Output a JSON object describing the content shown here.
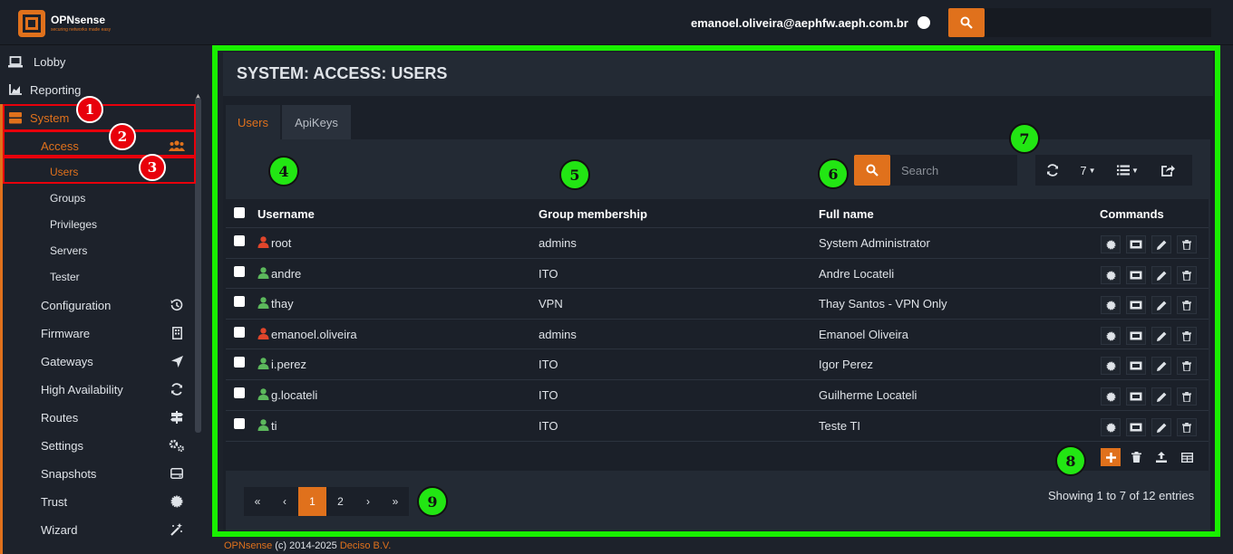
{
  "header": {
    "brand": "OPNsense",
    "tagline": "securing networks made easy",
    "user_email": "emanoel.oliveira@aephfw.aeph.com.br",
    "search_placeholder": ""
  },
  "sidebar": {
    "items": [
      {
        "label": "Lobby",
        "icon": "laptop-icon"
      },
      {
        "label": "Reporting",
        "icon": "area-chart-icon"
      },
      {
        "label": "System",
        "icon": "server-icon",
        "active": true
      },
      {
        "label": "Access",
        "icon": "users-icon",
        "active": true
      },
      {
        "label": "Users",
        "active": true
      },
      {
        "label": "Groups"
      },
      {
        "label": "Privileges"
      },
      {
        "label": "Servers"
      },
      {
        "label": "Tester"
      },
      {
        "label": "Configuration",
        "icon": "history-icon"
      },
      {
        "label": "Firmware",
        "icon": "building-icon"
      },
      {
        "label": "Gateways",
        "icon": "location-arrow-icon"
      },
      {
        "label": "High Availability",
        "icon": "refresh-icon"
      },
      {
        "label": "Routes",
        "icon": "map-signs-icon"
      },
      {
        "label": "Settings",
        "icon": "cogs-icon"
      },
      {
        "label": "Snapshots",
        "icon": "hdd-icon"
      },
      {
        "label": "Trust",
        "icon": "certificate-icon"
      },
      {
        "label": "Wizard",
        "icon": "magic-icon"
      }
    ]
  },
  "annotations": {
    "red": [
      "1",
      "2",
      "3"
    ],
    "green": [
      "4",
      "5",
      "6",
      "7",
      "8",
      "9"
    ]
  },
  "page": {
    "title": "SYSTEM: ACCESS: USERS",
    "tabs": [
      {
        "label": "Users",
        "active": true
      },
      {
        "label": "ApiKeys",
        "active": false
      }
    ],
    "search_placeholder": "Search",
    "row_count": "7",
    "table": {
      "columns": [
        "Username",
        "Group membership",
        "Full name",
        "Commands"
      ],
      "rows": [
        {
          "username": "root",
          "group": "admins",
          "fullname": "System Administrator",
          "admin": true
        },
        {
          "username": "andre",
          "group": "ITO",
          "fullname": "Andre Locateli",
          "admin": false
        },
        {
          "username": "thay",
          "group": "VPN",
          "fullname": "Thay Santos - VPN Only",
          "admin": false
        },
        {
          "username": "emanoel.oliveira",
          "group": "admins",
          "fullname": "Emanoel Oliveira",
          "admin": true
        },
        {
          "username": "i.perez",
          "group": "ITO",
          "fullname": "Igor Perez",
          "admin": false
        },
        {
          "username": "g.locateli",
          "group": "ITO",
          "fullname": "Guilherme Locateli",
          "admin": false
        },
        {
          "username": "ti",
          "group": "ITO",
          "fullname": "Teste TI",
          "admin": false
        }
      ]
    },
    "pagination": [
      "«",
      "‹",
      "1",
      "2",
      "›",
      "»"
    ],
    "active_page": "1",
    "showing": "Showing 1 to 7 of 12 entries"
  },
  "footer": {
    "brand": "OPNsense",
    "copyright": "(c) 2014-2025",
    "company": "Deciso B.V."
  },
  "colors": {
    "accent": "#e0711c",
    "admin_user": "#e0452b",
    "normal_user": "#5cb85c",
    "annotation_red": "#e8000b",
    "annotation_green": "#19f000"
  }
}
